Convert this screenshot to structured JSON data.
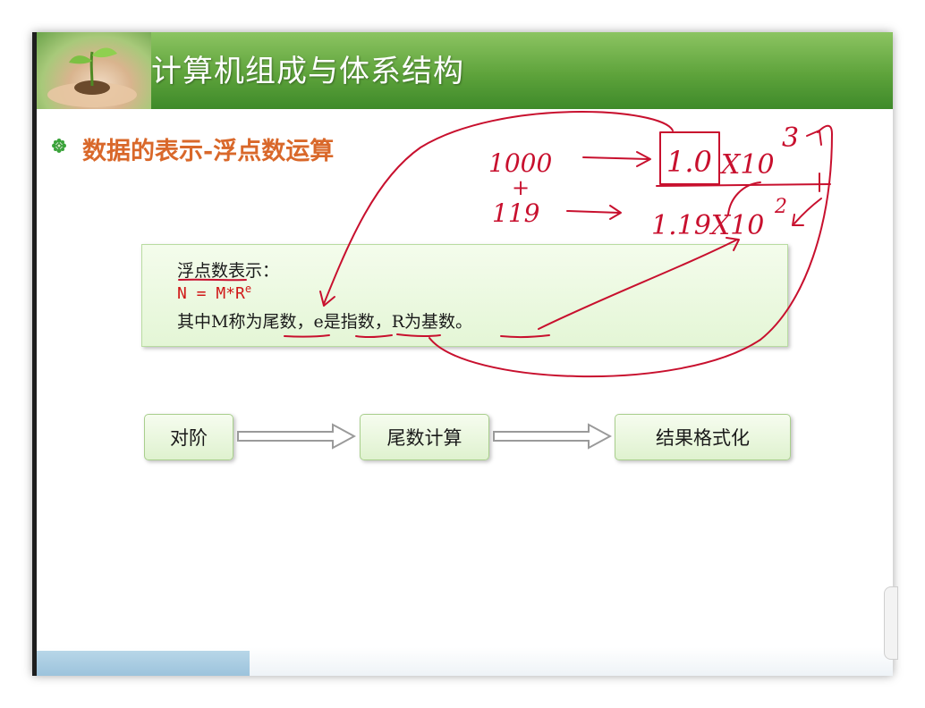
{
  "header": {
    "title": "计算机组成与体系结构"
  },
  "section": {
    "title": "数据的表示-浮点数运算"
  },
  "info_box": {
    "line1": "浮点数表示：",
    "line2_prefix": "N = M*R",
    "line2_exponent": "e",
    "line3": "其中M称为尾数，e是指数，R为基数。"
  },
  "flow": {
    "steps": [
      "对阶",
      "尾数计算",
      "结果格式化"
    ]
  },
  "handwriting": {
    "num1": "1000",
    "plus": "+",
    "num2": "119",
    "expr1_mantissa": "1.0",
    "expr1_base": "X10",
    "expr1_exp": "3",
    "expr2": "1.19X10",
    "expr2_exp": "2",
    "ink_color": "#c8102e"
  }
}
